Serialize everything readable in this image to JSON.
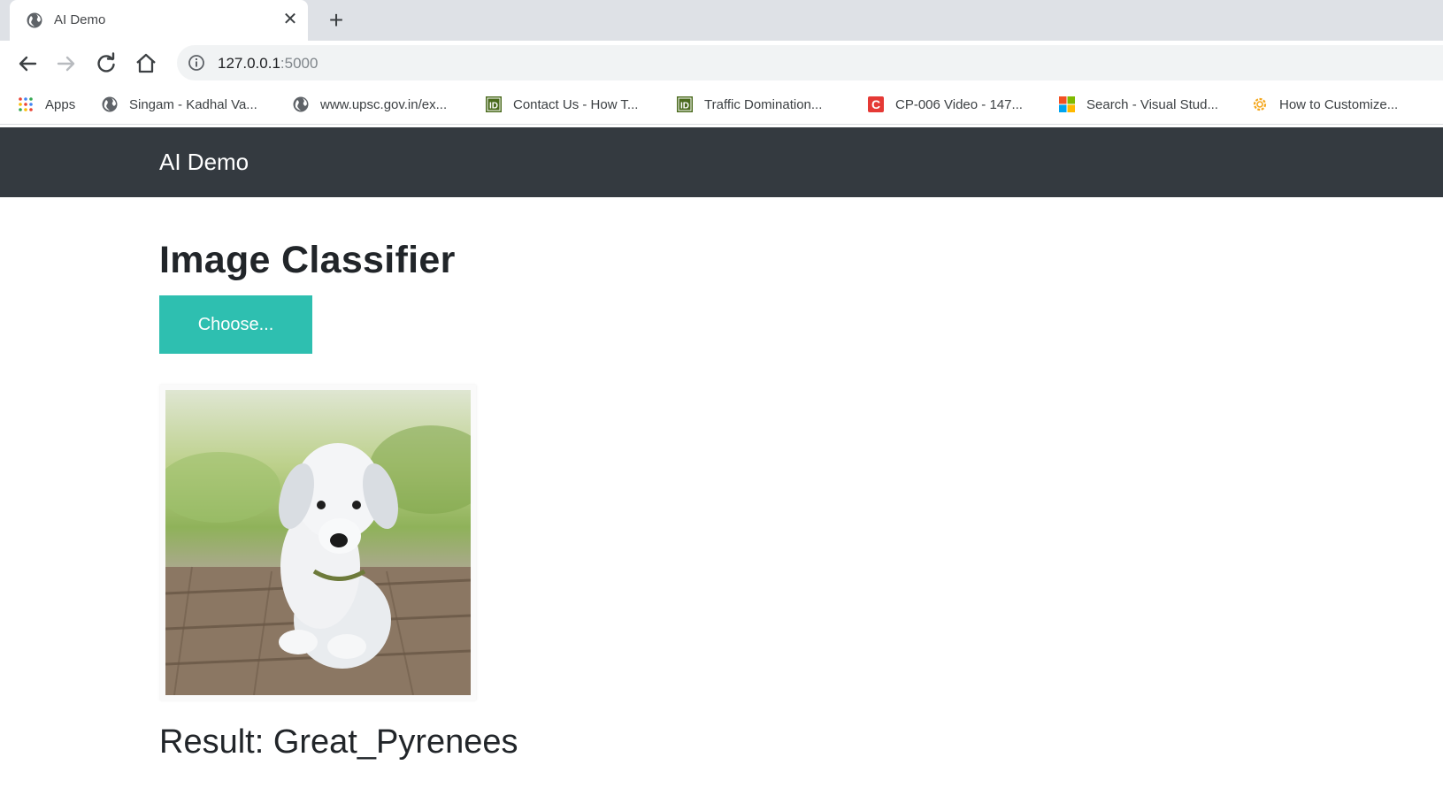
{
  "browser": {
    "tab": {
      "title": "AI Demo",
      "close_glyph": "✕",
      "favicon": "globe-icon"
    },
    "new_tab_glyph": "+",
    "address": {
      "host": "127.0.0.1",
      "port": ":5000"
    },
    "bookmarks": [
      {
        "label": "Apps",
        "icon": "apps-grid-icon"
      },
      {
        "label": "Singam - Kadhal Va...",
        "icon": "globe-icon"
      },
      {
        "label": "www.upsc.gov.in/ex...",
        "icon": "globe-icon"
      },
      {
        "label": "Contact Us - How T...",
        "icon": "id-icon"
      },
      {
        "label": "Traffic Domination...",
        "icon": "id-icon"
      },
      {
        "label": "CP-006 Video - 147...",
        "icon": "c-red-icon"
      },
      {
        "label": "Search - Visual Stud...",
        "icon": "microsoft-icon"
      },
      {
        "label": "How to Customize...",
        "icon": "gear-orange-icon"
      }
    ]
  },
  "navbar": {
    "brand": "AI Demo"
  },
  "main": {
    "title": "Image Classifier",
    "choose_label": "Choose...",
    "preview_image": "white-puppy-on-wooden-deck",
    "result_text": "Result: Great_Pyrenees"
  },
  "colors": {
    "navbar_bg": "#343a40",
    "button_bg": "#2ebfb0"
  }
}
